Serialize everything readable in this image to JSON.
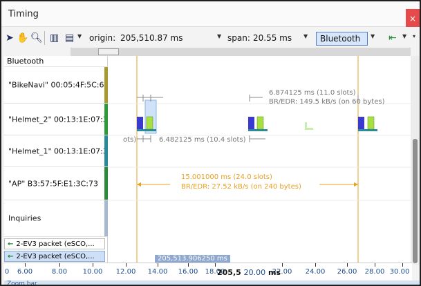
{
  "window": {
    "title": "Timing",
    "close_label": "×"
  },
  "toolbar": {
    "origin_label": "origin:",
    "origin_value": "205,510.87 ms",
    "span_label": "span:",
    "span_value": "20.55 ms",
    "technology": "Bluetooth",
    "icons": [
      "pointer-icon",
      "hand-icon",
      "zoom-icon",
      "layout-icon",
      "filter-icon",
      "insert-icon"
    ]
  },
  "sidebar": {
    "group": "Bluetooth",
    "devices": [
      {
        "label": "\"BikeNavi\" 00:05:4F:5C:6D...",
        "color": "#a89a2e"
      },
      {
        "label": "\"Helmet_2\" 00:13:1E:07:3...",
        "color": "#2e9a3a"
      },
      {
        "label": "\"Helmet_1\" 00:13:1E:07:3...",
        "color": "#2a8a9a"
      },
      {
        "label": "\"AP\" B3:57:5F:E1:3C:73",
        "color": "#2a8a3a"
      },
      {
        "label": "Inquiries",
        "color": "#a8b8d0"
      }
    ],
    "packets": [
      {
        "label": "2-EV3 packet (eSCO,..."
      },
      {
        "label": "2-EV3 packet (eSCO,..."
      }
    ]
  },
  "annotations": {
    "a1_line1": "6.874125 ms (11.0 slots)",
    "a1_line2": "BR/EDR:  149.5 kB/s (on 60 bytes)",
    "a2": "6.482125 ms (10.4 slots)",
    "a2_prefix": "ots)",
    "a3_line1": "15.001000 ms  (24.0 slots)",
    "a3_line2": "BR/EDR:  27.52 kB/s (on 240 bytes)"
  },
  "axis": {
    "ticks": [
      "6.00",
      "8.00",
      "10.00",
      "12.00",
      "14.00",
      "16.00",
      "18.00",
      "22.00",
      "24.00",
      "26.00",
      "28.00",
      "30.00"
    ],
    "leading": "0",
    "center_prefix": "205,5",
    "center_value": "20.00",
    "center_unit": "ms",
    "hover": "205,513.906250 ms"
  },
  "zoom_bar": "Zoom bar",
  "colors": {
    "accent": "#e8a020",
    "packet_blue": "#3a3ad0",
    "packet_green": "#a8e040"
  }
}
